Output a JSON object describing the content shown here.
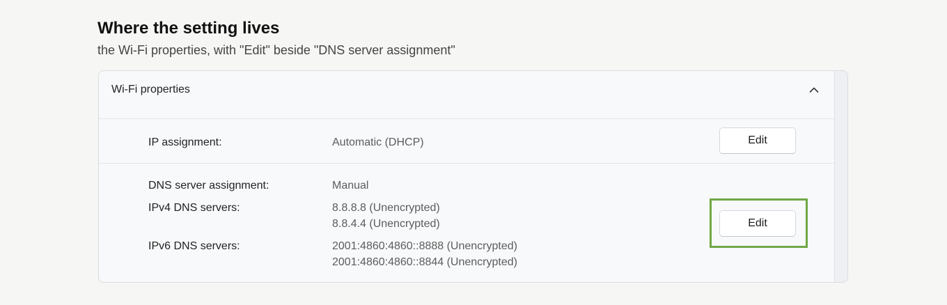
{
  "heading": "Where the setting lives",
  "subheading": "the Wi-Fi properties, with \"Edit\" beside \"DNS server assignment\"",
  "panel": {
    "title": "Wi-Fi properties",
    "collapse_icon": "chevron-up-icon",
    "ip_row": {
      "label": "IP assignment:",
      "value": "Automatic (DHCP)",
      "edit_label": "Edit"
    },
    "dns_row": {
      "assignment_label": "DNS server assignment:",
      "assignment_value": "Manual",
      "ipv4_label": "IPv4 DNS servers:",
      "ipv4_values": [
        "8.8.8.8 (Unencrypted)",
        "8.8.4.4 (Unencrypted)"
      ],
      "ipv6_label": "IPv6 DNS servers:",
      "ipv6_values": [
        "2001:4860:4860::8888 (Unencrypted)",
        "2001:4860:4860::8844 (Unencrypted)"
      ],
      "edit_label": "Edit"
    }
  },
  "colors": {
    "highlight": "#6fa845",
    "background": "#f6f6f4",
    "panel": "#f8f9fb"
  }
}
